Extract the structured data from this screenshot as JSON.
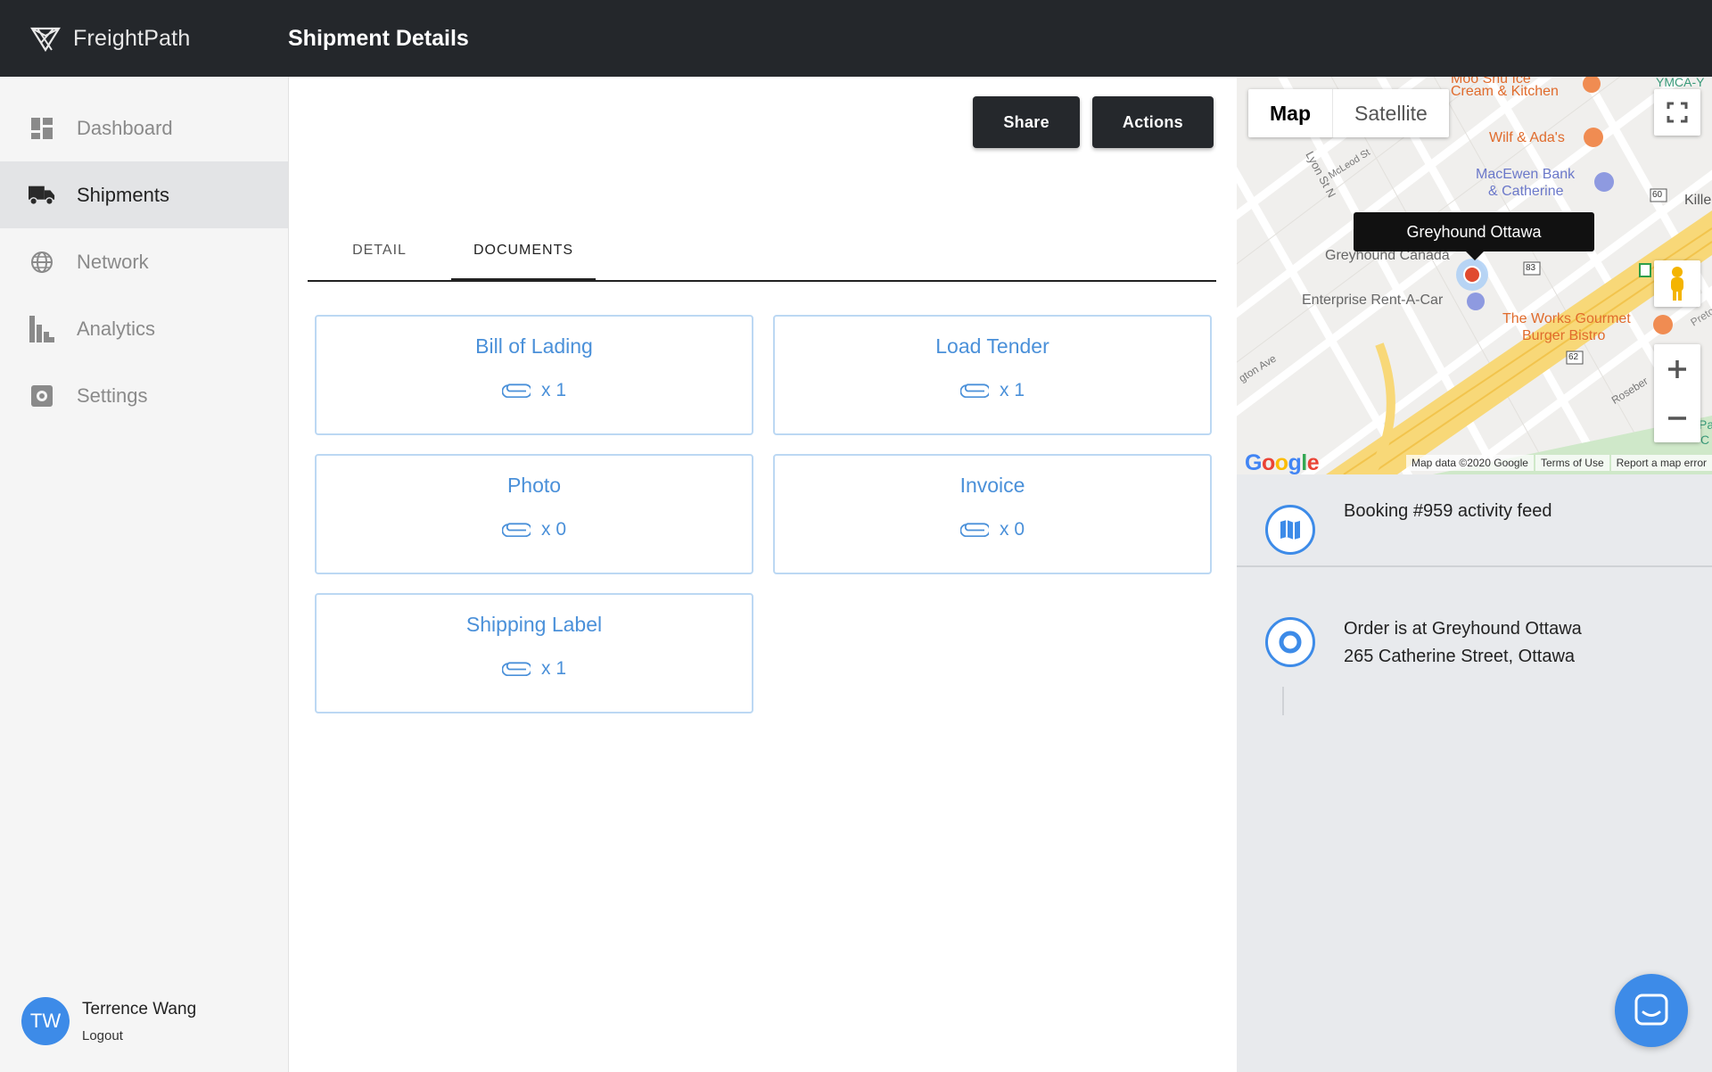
{
  "app": {
    "brand": "FreightPath",
    "page_title": "Shipment Details"
  },
  "sidebar": {
    "items": [
      {
        "label": "Dashboard",
        "icon": "dashboard-icon",
        "active": false
      },
      {
        "label": "Shipments",
        "icon": "truck-icon",
        "active": true
      },
      {
        "label": "Network",
        "icon": "globe-icon",
        "active": false
      },
      {
        "label": "Analytics",
        "icon": "bar-chart-icon",
        "active": false
      },
      {
        "label": "Settings",
        "icon": "gear-icon",
        "active": false
      }
    ],
    "user": {
      "initials": "TW",
      "name": "Terrence Wang",
      "logout": "Logout"
    }
  },
  "toolbar": {
    "share_label": "Share",
    "actions_label": "Actions"
  },
  "tabs": [
    {
      "label": "DETAIL",
      "active": false
    },
    {
      "label": "DOCUMENTS",
      "active": true
    }
  ],
  "documents": [
    {
      "title": "Bill of Lading",
      "count": "x 1"
    },
    {
      "title": "Load Tender",
      "count": "x 1"
    },
    {
      "title": "Photo",
      "count": "x 0"
    },
    {
      "title": "Invoice",
      "count": "x 0"
    },
    {
      "title": "Shipping Label",
      "count": "x 1"
    }
  ],
  "map": {
    "type_map": "Map",
    "type_satellite": "Satellite",
    "marker_tooltip": "Greyhound Ottawa",
    "labels": {
      "cream": "Cream & Kitchen",
      "moo": "Moo Shu Ice",
      "ymca": "YMCA-Y",
      "wilf": "Wilf & Ada's",
      "macewen1": "MacEwen Bank",
      "macewen2": "& Catherine",
      "greyhound": "Greyhound Canada",
      "enterprise": "Enterprise Rent-A-Car",
      "works1": "The Works Gourmet",
      "works2": "Burger Bistro",
      "lyon": "Lyon St N",
      "mcleod": "McLeod St",
      "gton": "gton Ave",
      "rosebery": "Roseber",
      "kille": "Kille",
      "preto": "Preto",
      "pa": "Pa",
      "c": "C",
      "r60": "60",
      "r83": "83",
      "r62": "62"
    },
    "google": "Google",
    "attribution": "Map data ©2020 Google",
    "terms": "Terms of Use",
    "report": "Report a map error"
  },
  "feed": {
    "title": "Booking #959 activity feed",
    "item_line1": "Order is at Greyhound Ottawa",
    "item_line2": "265 Catherine Street, Ottawa"
  },
  "colors": {
    "accent": "#3d8be8",
    "topbar": "#24272b",
    "card_border": "#bcd8f3",
    "link": "#4a90d9"
  }
}
